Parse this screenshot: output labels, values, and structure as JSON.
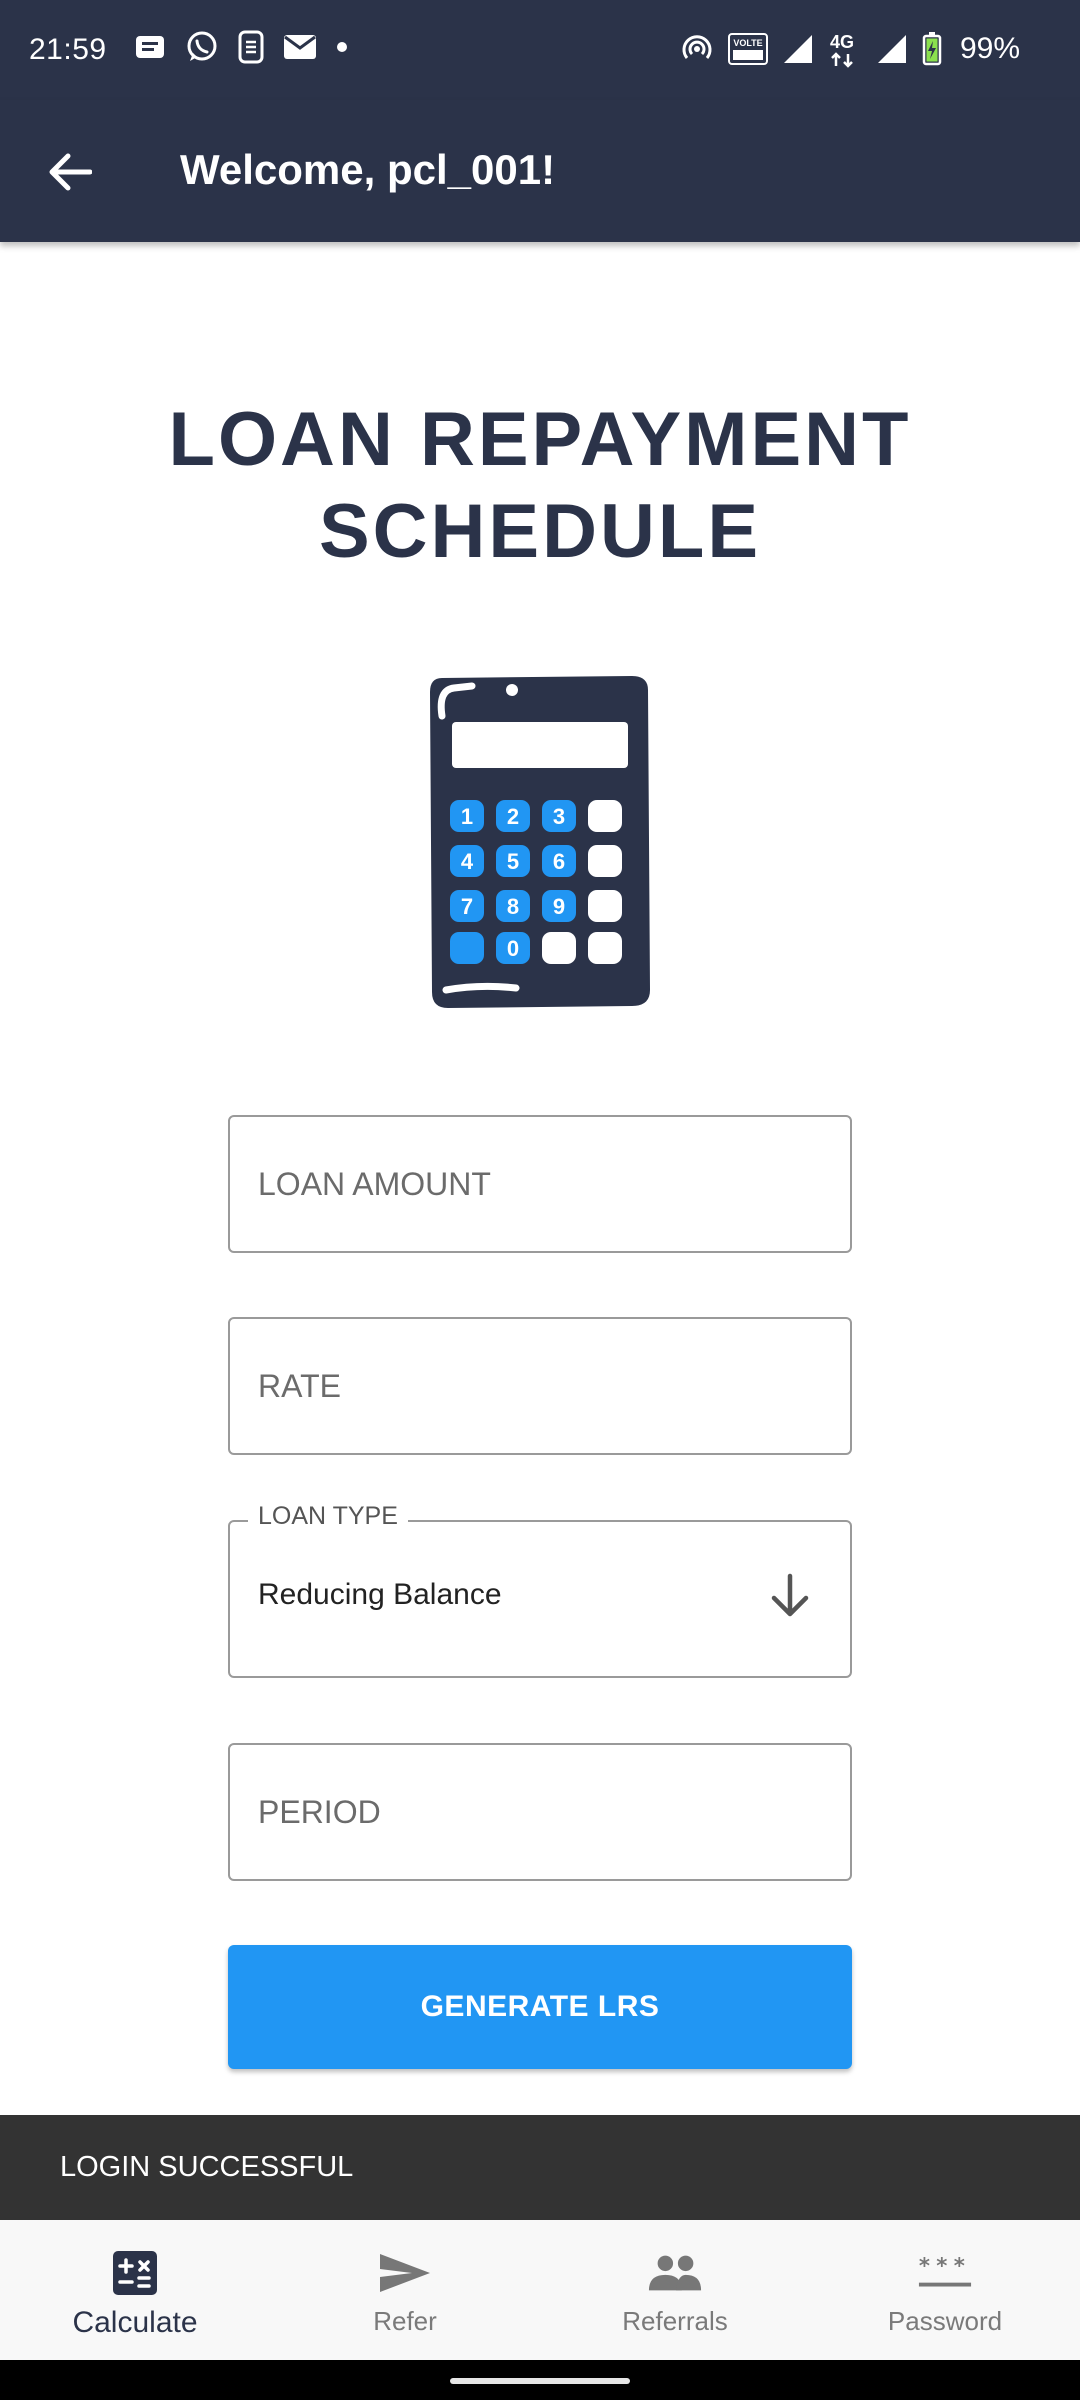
{
  "status_bar": {
    "time": "21:59",
    "battery_percent": "99%",
    "left_icons": [
      "message-icon",
      "whatsapp-icon",
      "sim-tool-icon",
      "mail-icon",
      "dot-icon"
    ],
    "right_icons": [
      "hotspot-icon",
      "volte-icon",
      "signal-icon",
      "4g-icon",
      "signal-icon",
      "battery-icon"
    ],
    "network_label": "4G",
    "volte_label": "VOLTE"
  },
  "app_bar": {
    "title": "Welcome, pcl_001!",
    "back_icon": "arrow-left-icon"
  },
  "main": {
    "title_line1": "LOAN REPAYMENT",
    "title_line2": "SCHEDULE",
    "calculator_keys": [
      "1",
      "2",
      "3",
      "4",
      "5",
      "6",
      "7",
      "8",
      "9",
      "0"
    ],
    "loan_amount": {
      "placeholder": "LOAN AMOUNT",
      "value": ""
    },
    "rate": {
      "placeholder": "RATE",
      "value": ""
    },
    "loan_type": {
      "label": "LOAN TYPE",
      "value": "Reducing Balance"
    },
    "period": {
      "placeholder": "PERIOD",
      "value": ""
    },
    "generate_label": "GENERATE LRS"
  },
  "snackbar": {
    "message": "LOGIN SUCCESSFUL"
  },
  "bottom_nav": {
    "items": [
      {
        "label": "Calculate",
        "icon": "calculator-icon",
        "active": true
      },
      {
        "label": "Refer",
        "icon": "send-icon",
        "active": false
      },
      {
        "label": "Referrals",
        "icon": "people-icon",
        "active": false
      },
      {
        "label": "Password",
        "icon": "password-icon",
        "active": false
      }
    ]
  },
  "colors": {
    "primary_dark": "#2b3349",
    "accent": "#2196f3",
    "snackbar_bg": "#333333"
  }
}
